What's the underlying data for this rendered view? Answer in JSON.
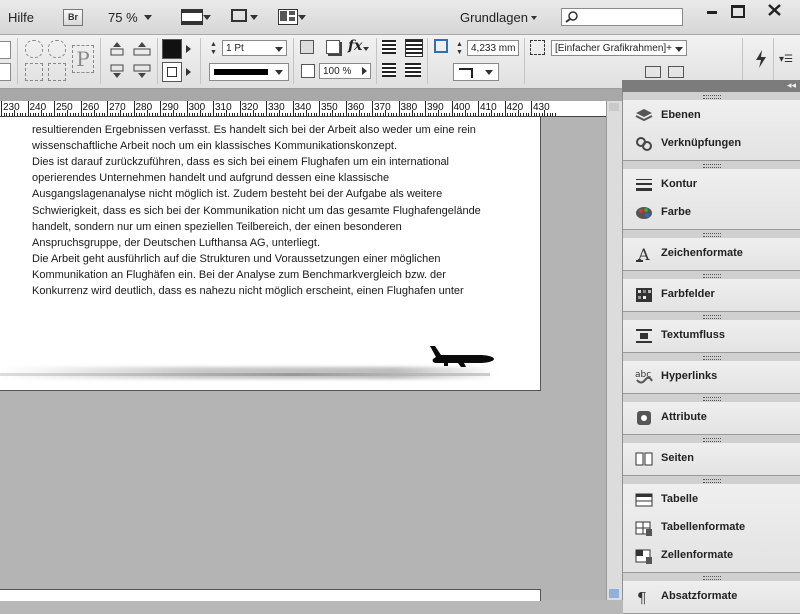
{
  "menubar": {
    "help": "Hilfe",
    "bridge": "Br",
    "zoom": "75 %",
    "workspace": "Grundlagen"
  },
  "controlbar": {
    "stroke_weight": "1 Pt",
    "opacity": "100 %",
    "measure": "4,233 mm",
    "frame_style": "[Einfacher Grafikrahmen]+"
  },
  "ruler": {
    "ticks": [
      "230",
      "240",
      "250",
      "260",
      "270",
      "280",
      "290",
      "300",
      "310",
      "320",
      "330",
      "340",
      "350",
      "360",
      "370",
      "380",
      "390",
      "400",
      "410",
      "420",
      "430"
    ]
  },
  "document": {
    "lines": [
      "resultierenden Ergebnissen verfasst. Es handelt sich bei der Arbeit also weder um eine rein",
      "wissenschaftliche Arbeit noch um ein klassisches Kommunikationskonzept.",
      "Dies ist darauf zurückzuführen, dass es sich bei einem Flughafen um ein international",
      "operierendes Unternehmen handelt und aufgrund dessen eine klassische",
      "Ausgangslagenanalyse nicht möglich ist. Zudem besteht bei der Aufgabe als weitere",
      "Schwierigkeit, dass es sich bei der Kommunikation nicht um das gesamte Flughafengelände",
      "handelt, sondern nur um einen speziellen Teilbereich, der einen besonderen",
      "Anspruchsgruppe, der Deutschen Lufthansa AG, unterliegt.",
      "Die Arbeit geht ausführlich auf die Strukturen und Voraussetzungen einer möglichen",
      "Kommunikation an Flughäfen ein. Bei der Analyse zum Benchmarkvergleich bzw. der",
      "Konkurrenz wird deutlich, dass es nahezu nicht möglich erscheint, einen Flughafen unter"
    ]
  },
  "panels": {
    "items": [
      {
        "label": "Ebenen",
        "icon": "layers-icon"
      },
      {
        "label": "Verknüpfungen",
        "icon": "links-icon"
      },
      {
        "label": "Kontur",
        "icon": "stroke-icon"
      },
      {
        "label": "Farbe",
        "icon": "color-icon"
      },
      {
        "label": "Zeichenformate",
        "icon": "character-styles-icon"
      },
      {
        "label": "Farbfelder",
        "icon": "swatches-icon"
      },
      {
        "label": "Textumfluss",
        "icon": "text-wrap-icon"
      },
      {
        "label": "Hyperlinks",
        "icon": "hyperlinks-icon"
      },
      {
        "label": "Attribute",
        "icon": "attributes-icon"
      },
      {
        "label": "Seiten",
        "icon": "pages-icon"
      },
      {
        "label": "Tabelle",
        "icon": "table-icon"
      },
      {
        "label": "Tabellenformate",
        "icon": "table-styles-icon"
      },
      {
        "label": "Zellenformate",
        "icon": "cell-styles-icon"
      },
      {
        "label": "Absatzformate",
        "icon": "paragraph-styles-icon"
      }
    ]
  }
}
